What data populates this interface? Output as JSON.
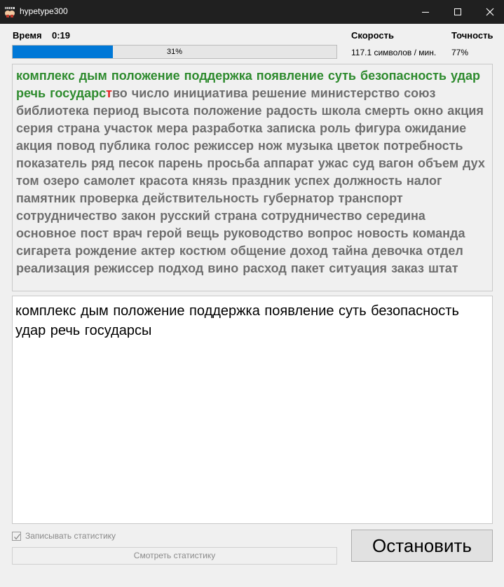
{
  "window": {
    "title": "hypetype300",
    "icons": {
      "app": "app-icon",
      "minimize": "minimize-icon",
      "maximize": "maximize-icon",
      "close": "close-icon"
    }
  },
  "stats": {
    "time_label": "Время",
    "time_value": "0:19",
    "speed_label": "Скорость",
    "speed_value": "117.1 символов / мин.",
    "accuracy_label": "Точность",
    "accuracy_value": "77%",
    "progress_percent": 31,
    "progress_text": "31%"
  },
  "target": {
    "typed_correct": "комплекс дым положение поддержка появление суть безопасность удар речь государс",
    "typed_error": "т",
    "remaining": "во число инициатива решение министерство союз библиотека период высота положение радость школа смерть окно акция серия страна участок мера разработка записка роль фигура ожидание акция повод публика голос режиссер нож музыка цветок потребность показатель ряд песок парень просьба аппарат ужас суд вагон объем дух том озеро самолет красота князь праздник успех должность налог памятник проверка действительность губернатор транспорт сотрудничество закон русский страна сотрудничество середина основное пост врач герой вещь руководство вопрос новость команда сигарета рождение актер костюм общение доход тайна девочка отдел реализация режиссер подход вино расход пакет ситуация заказ штат"
  },
  "input": {
    "value": "комплекс дым положение поддержка появление суть безопасность удар речь государсы"
  },
  "controls": {
    "record_stats_label": "Записывать статистику",
    "record_stats_checked": true,
    "view_stats_label": "Смотреть статистику",
    "stop_label": "Остановить"
  },
  "colors": {
    "titlebar": "#202020",
    "progress_fill": "#0078d7",
    "typed_correct": "#2e8b2e",
    "typed_error": "#e02020",
    "remaining": "#6e6e6e"
  }
}
